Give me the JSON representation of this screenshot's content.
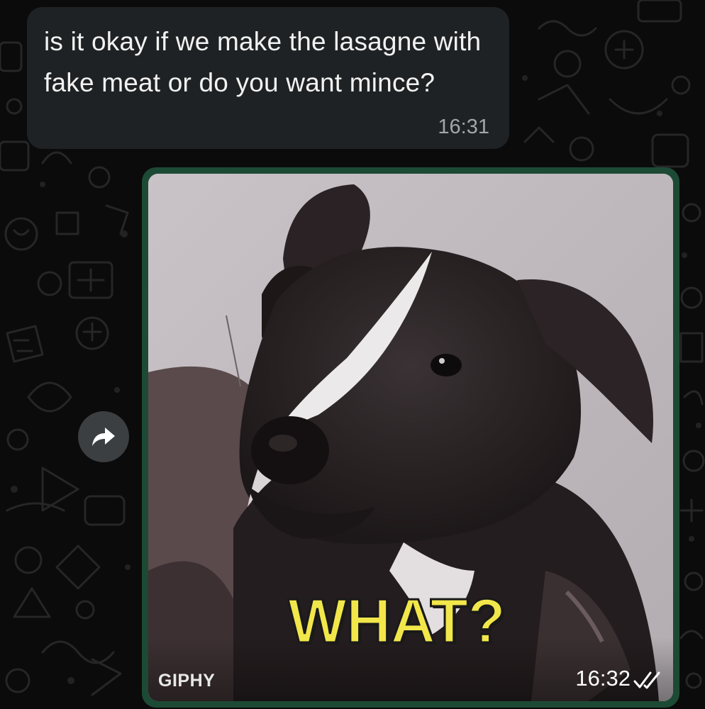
{
  "incoming_message": {
    "text": "is it okay if we make the lasagne with fake meat or do you want mince?",
    "time": "16:31"
  },
  "outgoing_gif": {
    "caption": "WHAT?",
    "source_label": "GIPHY",
    "time": "16:32",
    "status_icon": "double-check-icon"
  },
  "forward_action": {
    "icon": "forward-arrow-icon"
  },
  "colors": {
    "wallpaper": "#0b0b0b",
    "incoming_bubble": "#1f2224",
    "outgoing_bubble": "#1d4a35",
    "caption": "#f2e74a"
  }
}
